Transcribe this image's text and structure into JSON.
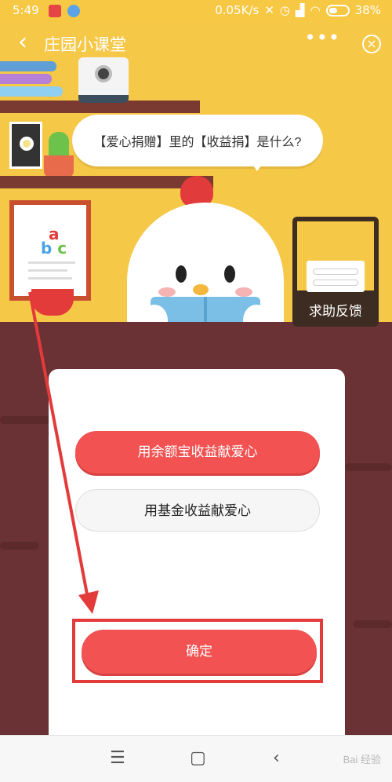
{
  "status_bar": {
    "time": "5:49",
    "network_speed": "0.05K/s",
    "battery": "38%"
  },
  "header": {
    "title": "庄园小课堂",
    "back_icon": "chevron-left-icon",
    "more_icon": "more-dots-icon",
    "close_icon": "close-circle-icon"
  },
  "quiz": {
    "question": "【爱心捐赠】里的【收益捐】是什么?"
  },
  "help_feedback": {
    "label": "求助反馈"
  },
  "options": [
    {
      "label": "用余额宝收益献爱心",
      "selected": true
    },
    {
      "label": "用基金收益献爱心",
      "selected": false
    }
  ],
  "confirm": {
    "label": "确定"
  },
  "navigation": {
    "menu_icon": "menu-icon",
    "home_icon": "square-home-icon",
    "back_icon": "back-arrow-icon"
  },
  "watermark": "Bai 经验",
  "colors": {
    "accent": "#f25252",
    "annotation": "#e33a3a",
    "scene_background": "#f6c848",
    "floor": "#6a3234"
  }
}
